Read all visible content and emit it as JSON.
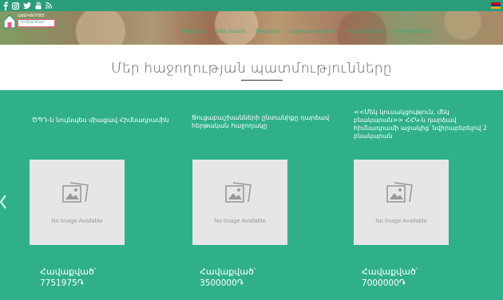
{
  "topbar": {
    "social_icons": [
      "facebook-icon",
      "instagram-icon",
      "twitter-icon",
      "youtube-icon",
      "rss-icon"
    ],
    "language_flag": "armenian-flag",
    "colors": {
      "bar": "#2a9e7a",
      "flag": [
        "#d90012",
        "#0033a0",
        "#f2a800"
      ]
    }
  },
  "brand": {
    "line1": "ԱՋԱԿՑՈՒԹՅ",
    "line2": "ՀԻՄՆԱԴՐԱՄ"
  },
  "nav": {
    "items": [
      "Գլխավոր",
      "Մեր մասին",
      "Ծրագրեր",
      "Նվիրատվություն",
      "Կապ մեզ հետ",
      "Նորություններ"
    ]
  },
  "heading": "Մեր հաջողության պատմությունները",
  "colors": {
    "accent": "#2fb08a",
    "heading": "#555555",
    "placeholder": "#e6e6e6"
  },
  "cards": [
    {
      "title": "ԾՊԴ-ն նույնպես միացավ Հիմնադրամին",
      "no_image": "No Image Available",
      "label": "Հավաքված՝",
      "price": "7751975֏"
    },
    {
      "title": "Ցուցաբաշխանների ընտանիքը դարձավ հերթական հաջողակը",
      "no_image": "No Image Available",
      "label": "Հավաքված՝",
      "price": "3500000֏"
    },
    {
      "title": "<<Մեկ կուսակցություն, մեկ բնակարան>> ՀՀԿ-ն դարձավ հիմնադրամի աջակից՝ նվիրաբերելով 2 բնակարան",
      "no_image": "No Image Available",
      "label": "Հավաքված՝",
      "price": "7000000֏"
    }
  ]
}
